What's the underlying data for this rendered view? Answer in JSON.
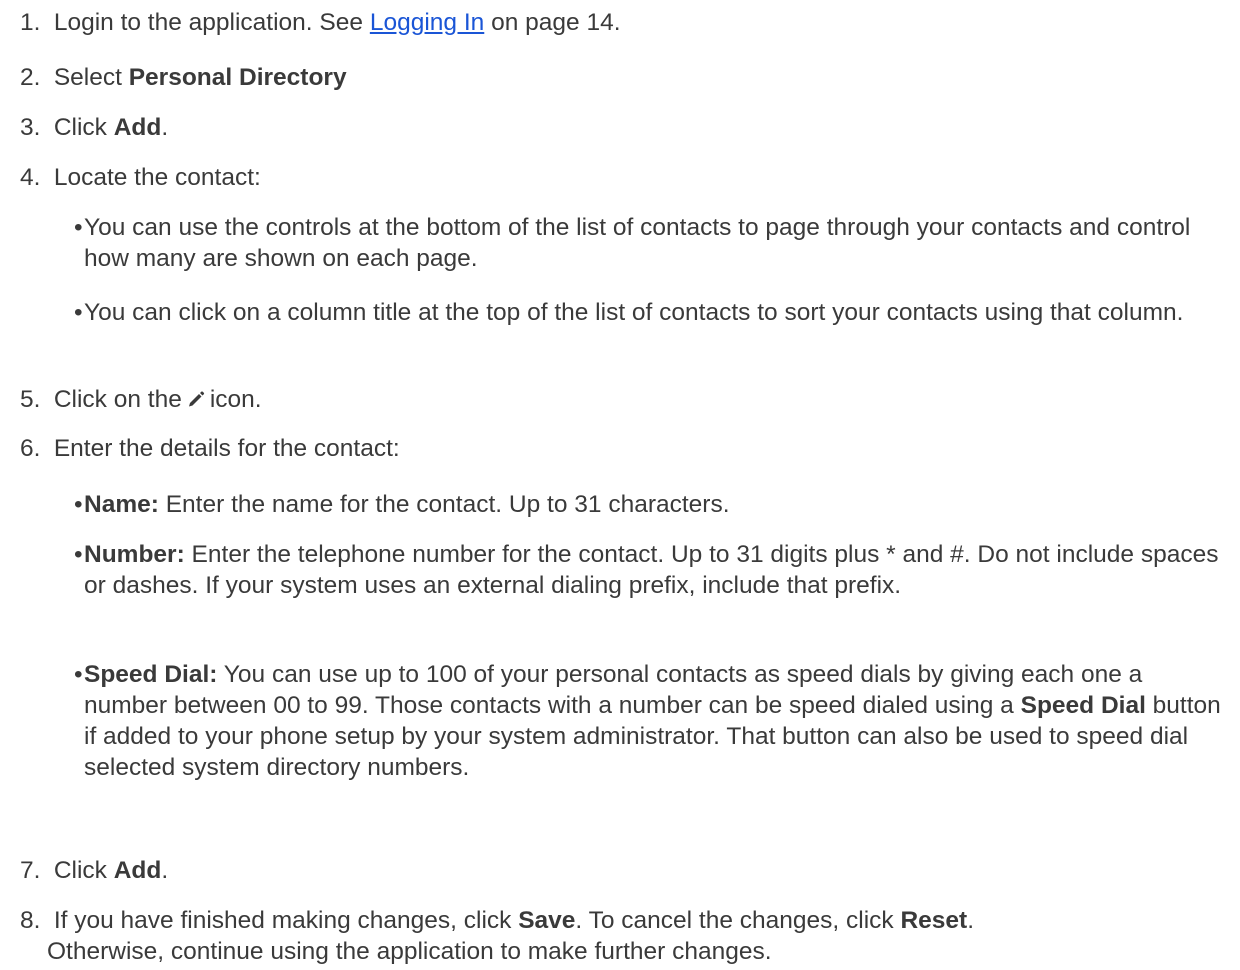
{
  "steps": [
    {
      "num": "1.",
      "before": "Login to the application. See ",
      "link": "Logging In",
      "after": " on page 14."
    },
    {
      "num": "2.",
      "before": "Select ",
      "bold": "Personal Directory"
    },
    {
      "num": "3.",
      "before": "Click ",
      "bold": "Add",
      "after": "."
    },
    {
      "num": "4.",
      "text": "Locate the contact:",
      "bullets": [
        "You can use the controls at the bottom of the list of contacts to page through your contacts and control how many are shown on each page.",
        "You can click on a column title at the top of the list of contacts to sort your contacts using that column."
      ]
    },
    {
      "num": "5.",
      "before": "Click on the",
      "icon": "pencil-icon",
      "after": "icon."
    },
    {
      "num": "6.",
      "text": "Enter the details for the contact:",
      "bullets": [
        {
          "label": "Name:",
          "text": " Enter the name for the contact. Up to 31 characters."
        },
        {
          "label": "Number:",
          "text": " Enter the telephone number for the contact. Up to 31 digits plus * and #. Do not include spaces or dashes. If your system uses an external dialing prefix, include that prefix."
        },
        {
          "label": "Speed Dial:",
          "text_a": " You can use up to 100 of your personal contacts as speed dials by giving each one a number between 00 to 99. Those contacts with a number can be speed dialed using a ",
          "bold_mid": "Speed Dial",
          "text_b": " button if added to your phone setup by your system administrator. That button can also be used to speed dial selected system directory numbers."
        }
      ]
    },
    {
      "num": "7.",
      "before": "Click ",
      "bold": "Add",
      "after": "."
    },
    {
      "num": "8.",
      "t1": "If you have finished making changes, click ",
      "b1": "Save",
      "t2": ". To cancel the changes, click ",
      "b2": "Reset",
      "t3": ".",
      "t4": "Otherwise, continue using the application to make further changes."
    }
  ],
  "bullet_char": "•"
}
